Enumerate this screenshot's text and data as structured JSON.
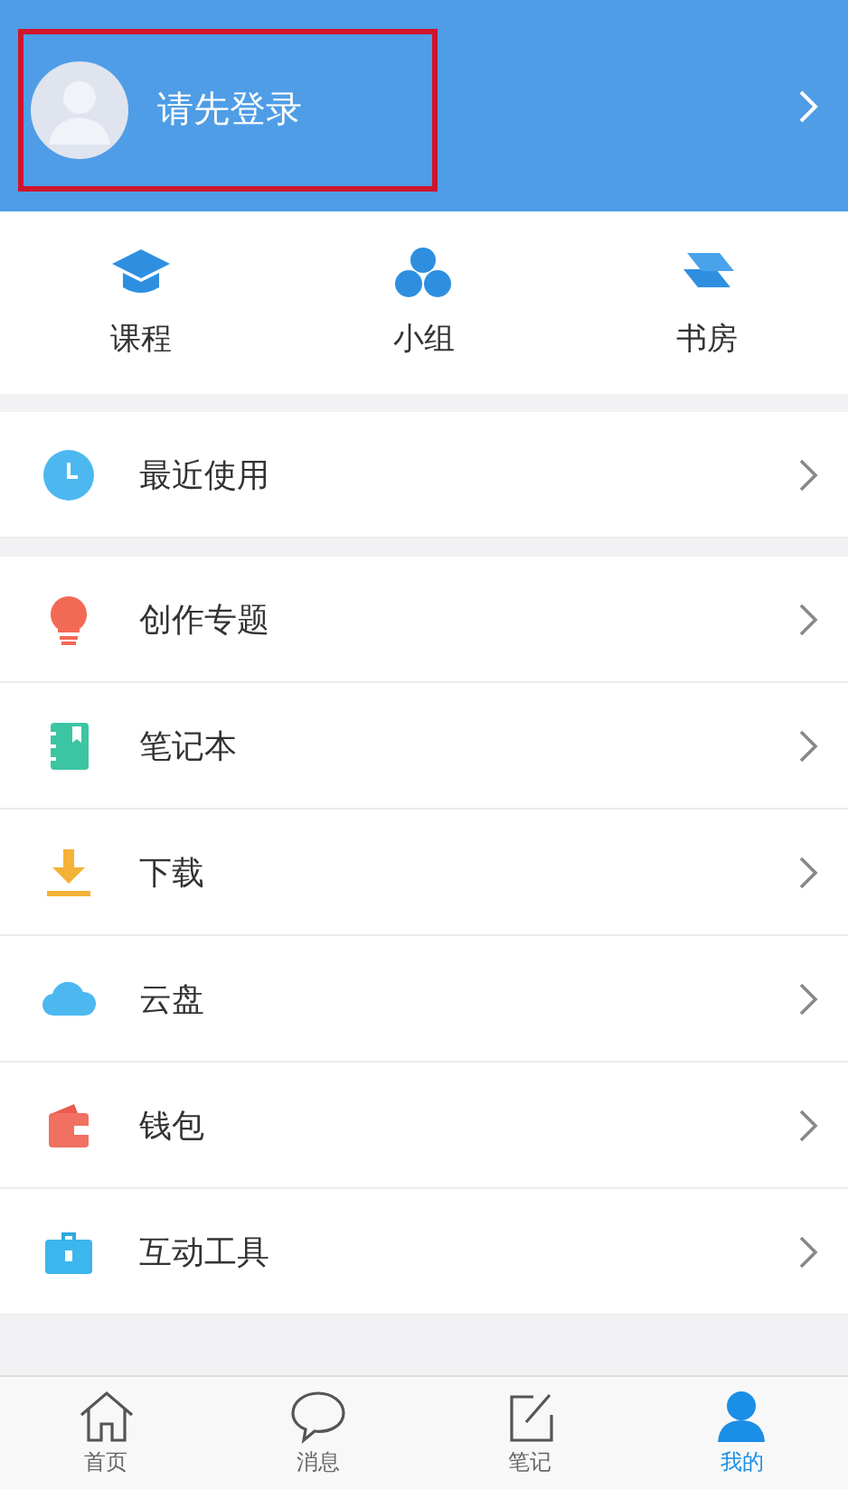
{
  "profile": {
    "name": "请先登录",
    "highlighted": true
  },
  "shortcuts": [
    {
      "label": "课程"
    },
    {
      "label": "小组"
    },
    {
      "label": "书房"
    }
  ],
  "menu_groups": [
    {
      "items": [
        {
          "label": "最近使用"
        }
      ]
    },
    {
      "items": [
        {
          "label": "创作专题"
        },
        {
          "label": "笔记本"
        },
        {
          "label": "下载"
        },
        {
          "label": "云盘"
        },
        {
          "label": "钱包"
        },
        {
          "label": "互动工具"
        }
      ]
    }
  ],
  "tab_bar": [
    {
      "label": "首页",
      "selected": false
    },
    {
      "label": "消息",
      "selected": false
    },
    {
      "label": "笔记",
      "selected": false
    },
    {
      "label": "我的",
      "selected": true
    }
  ]
}
